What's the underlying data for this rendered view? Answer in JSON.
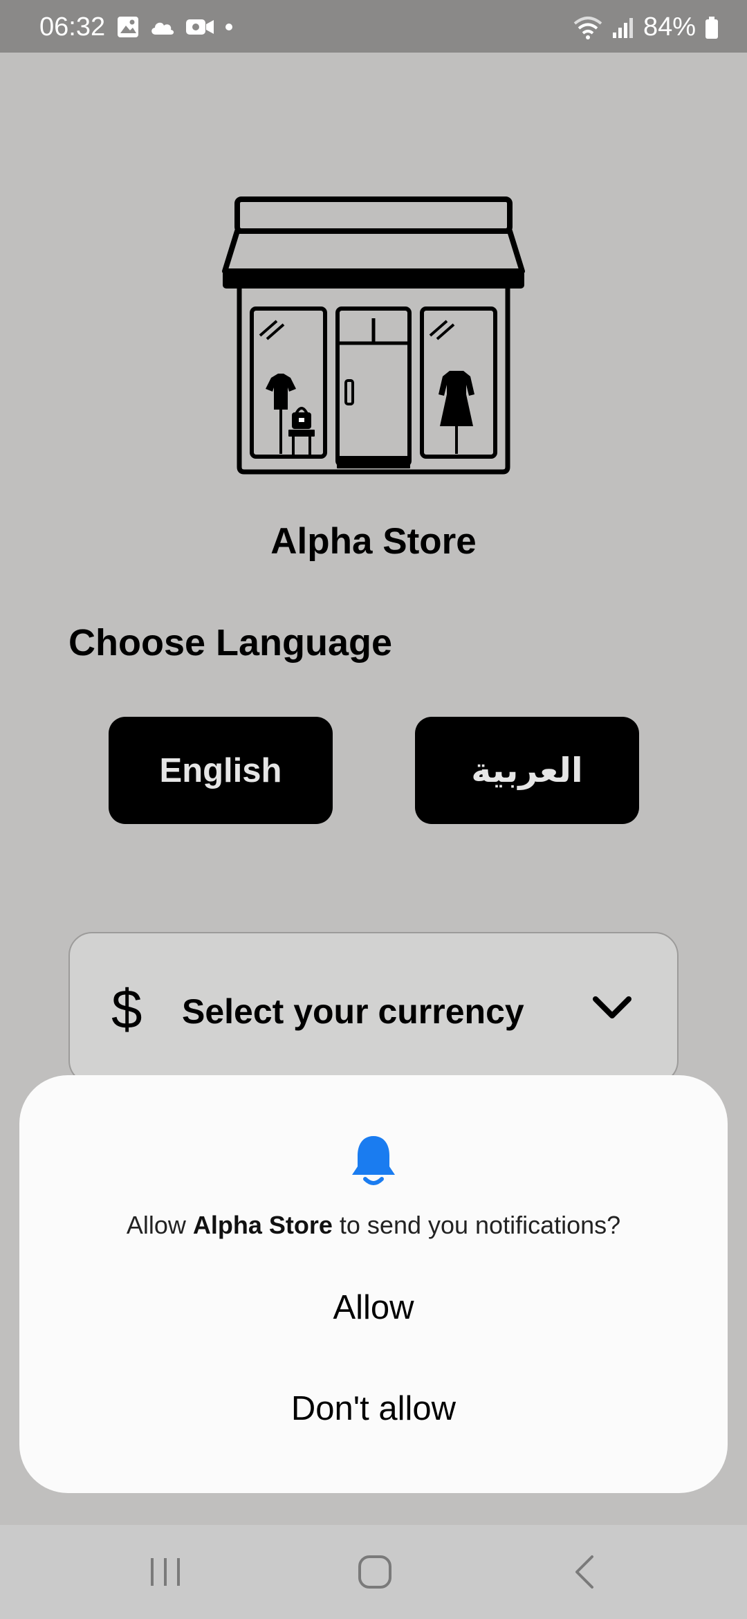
{
  "status_bar": {
    "time": "06:32",
    "battery": "84%",
    "left_icons": [
      "gallery-icon",
      "cloud-icon",
      "video-icon",
      "dot-icon"
    ],
    "right_icons": [
      "wifi-icon",
      "signal-icon",
      "battery-icon"
    ]
  },
  "app": {
    "name": "Alpha Store",
    "logo_icon": "storefront-icon"
  },
  "language": {
    "heading": "Choose Language",
    "options": [
      "English",
      "العربية"
    ]
  },
  "currency": {
    "icon": "dollar-icon",
    "symbol": "$",
    "placeholder": "Select your currency"
  },
  "notification_dialog": {
    "icon": "bell-icon",
    "message_prefix": "Allow ",
    "message_app": "Alpha Store",
    "message_suffix": " to send you notifications?",
    "allow_label": "Allow",
    "deny_label": "Don't allow",
    "accent_color": "#1a7cf0"
  },
  "nav_bar": {
    "buttons": [
      "recent-apps-icon",
      "home-icon",
      "back-icon"
    ]
  }
}
